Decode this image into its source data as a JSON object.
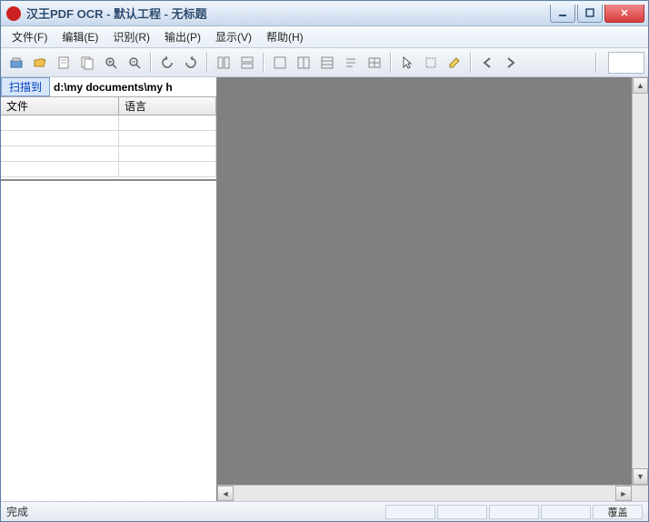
{
  "titlebar": {
    "title": "汉王PDF OCR - 默认工程 - 无标题"
  },
  "menu": {
    "file": "文件(F)",
    "edit": "编辑(E)",
    "recognize": "识别(R)",
    "output": "输出(P)",
    "view": "显示(V)",
    "help": "帮助(H)"
  },
  "toolbar_icons": {
    "scan": "scan",
    "open": "open",
    "page_prev": "page-prev",
    "page_next": "page-next",
    "zoom_in": "zoom-in",
    "zoom_out": "zoom-out",
    "rotate_left": "rotate-left",
    "rotate_right": "rotate-right",
    "layout1": "layout1",
    "layout2": "layout2",
    "view1": "view1",
    "view2": "view2",
    "view3": "view3",
    "view4": "view4",
    "view5": "view5",
    "cursor": "cursor",
    "select": "select",
    "edit": "edit",
    "prev": "prev",
    "next": "next"
  },
  "sidebar": {
    "scan_label": "扫描到",
    "scan_path": "d:\\my documents\\my h",
    "col_file": "文件",
    "col_lang": "语言"
  },
  "statusbar": {
    "ready": "完成",
    "overwrite": "覆盖"
  },
  "colors": {
    "viewer_bg": "#808080"
  }
}
